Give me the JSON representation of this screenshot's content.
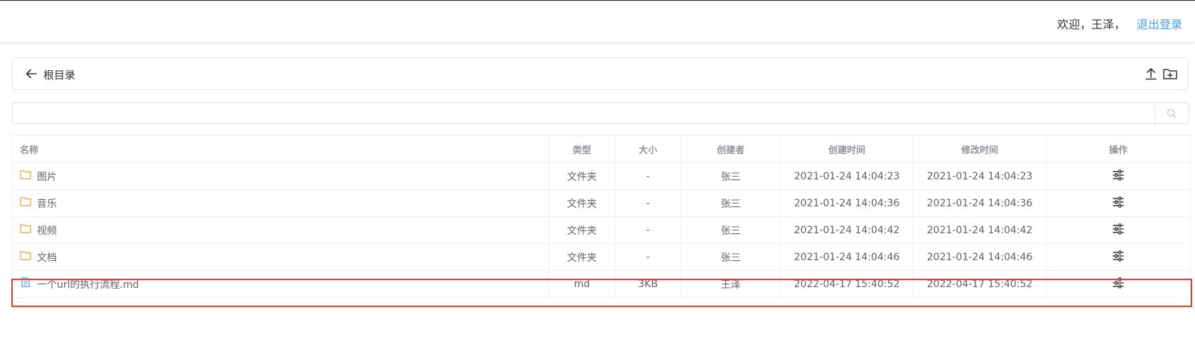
{
  "header": {
    "welcome": "欢迎，王泽，",
    "logout": "退出登录"
  },
  "path": {
    "back_icon": "arrow-left-icon",
    "current": "根目录",
    "upload_icon": "upload-icon",
    "new_folder_icon": "folder-add-icon"
  },
  "search": {
    "placeholder": "",
    "icon": "search-icon"
  },
  "table": {
    "headers": [
      "名称",
      "类型",
      "大小",
      "创建者",
      "创建时间",
      "修改时间",
      "操作"
    ],
    "rows": [
      {
        "icon": "folder-icon",
        "name": "图片",
        "type": "文件夹",
        "size": "-",
        "creator": "张三",
        "created": "2021-01-24 14:04:23",
        "modified": "2021-01-24 14:04:23"
      },
      {
        "icon": "folder-icon",
        "name": "音乐",
        "type": "文件夹",
        "size": "-",
        "creator": "张三",
        "created": "2021-01-24 14:04:36",
        "modified": "2021-01-24 14:04:36"
      },
      {
        "icon": "folder-icon",
        "name": "视频",
        "type": "文件夹",
        "size": "-",
        "creator": "张三",
        "created": "2021-01-24 14:04:42",
        "modified": "2021-01-24 14:04:42"
      },
      {
        "icon": "folder-icon",
        "name": "文档",
        "type": "文件夹",
        "size": "-",
        "creator": "张三",
        "created": "2021-01-24 14:04:46",
        "modified": "2021-01-24 14:04:46"
      },
      {
        "icon": "document-icon",
        "name": "一个url的执行流程.md",
        "type": "md",
        "size": "3KB",
        "creator": "王泽",
        "created": "2022-04-17 15:40:52",
        "modified": "2022-04-17 15:40:52"
      }
    ],
    "action_icon": "sliders-icon",
    "highlighted_row": 5
  },
  "colors": {
    "accent": "#409eff",
    "folder": "#e6a23c",
    "document": "#409eff",
    "highlight": "#e53935"
  }
}
